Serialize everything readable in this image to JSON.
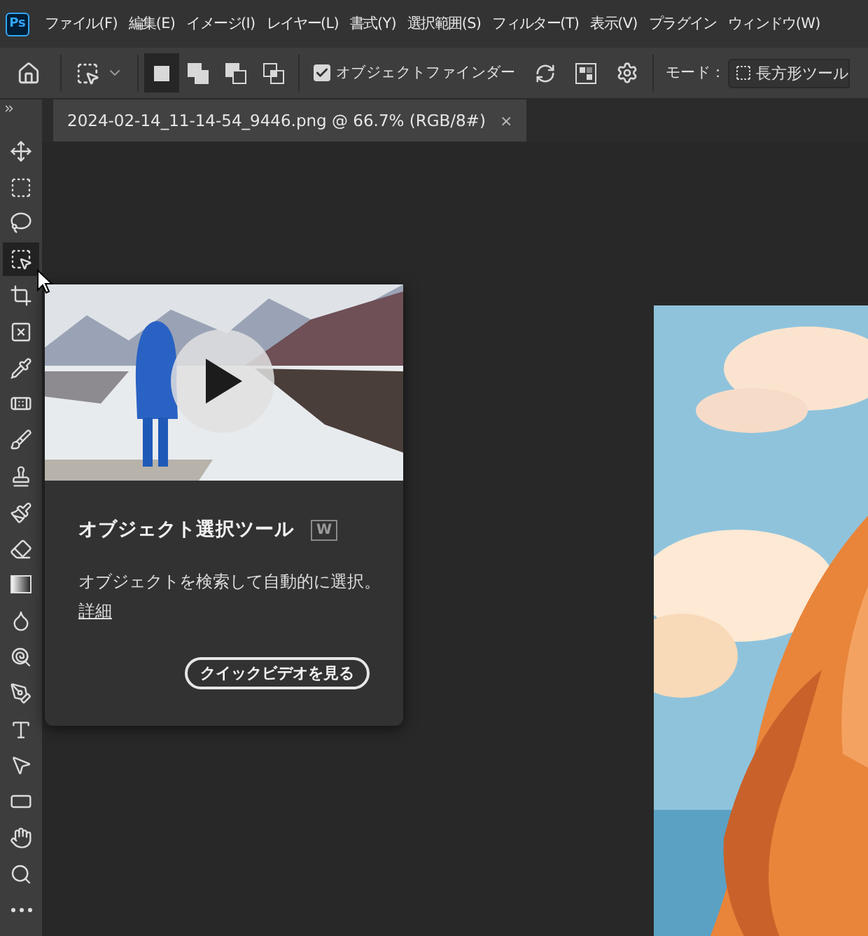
{
  "app_logo": "Ps",
  "menu": [
    {
      "label": "ファイル(F)"
    },
    {
      "label": "編集(E)"
    },
    {
      "label": "イメージ(I)"
    },
    {
      "label": "レイヤー(L)"
    },
    {
      "label": "書式(Y)"
    },
    {
      "label": "選択範囲(S)"
    },
    {
      "label": "フィルター(T)"
    },
    {
      "label": "表示(V)"
    },
    {
      "label": "プラグイン"
    },
    {
      "label": "ウィンドウ(W)"
    }
  ],
  "options_bar": {
    "selection_modes": [
      {
        "kind": "new",
        "selected": true
      },
      {
        "kind": "add",
        "selected": false
      },
      {
        "kind": "subtract",
        "selected": false
      },
      {
        "kind": "intersect",
        "selected": false
      }
    ],
    "object_finder": {
      "label": "オブジェクトファインダー",
      "checked": true
    },
    "mode_label": "モード：",
    "mode_value": "長方形ツール"
  },
  "document_tab": {
    "title": "2024-02-14_11-14-54_9446.png @ 66.7% (RGB/8#)",
    "close": "×"
  },
  "tools": [
    {
      "kind": "move",
      "selected": false
    },
    {
      "kind": "marquee",
      "selected": false
    },
    {
      "kind": "lasso",
      "selected": false
    },
    {
      "kind": "object_select",
      "selected": true
    },
    {
      "kind": "crop",
      "selected": false
    },
    {
      "kind": "frame",
      "selected": false
    },
    {
      "kind": "eyedropper",
      "selected": false
    },
    {
      "kind": "healing",
      "selected": false
    },
    {
      "kind": "brush",
      "selected": false
    },
    {
      "kind": "stamp",
      "selected": false
    },
    {
      "kind": "history_brush",
      "selected": false
    },
    {
      "kind": "eraser",
      "selected": false
    },
    {
      "kind": "gradient",
      "selected": false
    },
    {
      "kind": "blur",
      "selected": false
    },
    {
      "kind": "dodge",
      "selected": false
    },
    {
      "kind": "pen",
      "selected": false
    },
    {
      "kind": "type",
      "selected": false
    },
    {
      "kind": "path_select",
      "selected": false
    },
    {
      "kind": "rectangle",
      "selected": false
    },
    {
      "kind": "hand",
      "selected": false
    },
    {
      "kind": "zoom",
      "selected": false
    },
    {
      "kind": "more",
      "selected": false
    }
  ],
  "tooltip": {
    "title": "オブジェクト選択ツール",
    "shortcut": "W",
    "description": "オブジェクトを検索して自動的に選択。",
    "link": "詳細",
    "button": "クイックビデオを見る"
  }
}
